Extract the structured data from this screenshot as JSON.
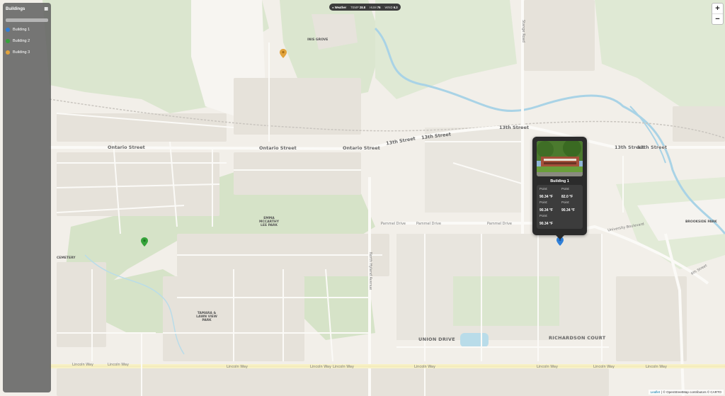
{
  "map": {
    "street_labels": {
      "ontario_w": "Ontario Street",
      "ontario_m": "Ontario Street",
      "ontario_e": "Ontario Street",
      "thirteenth_1": "13th Street",
      "thirteenth_2": "13th Street",
      "thirteenth_3": "13th Street",
      "thirteenth_4": "13th Street",
      "thirteenth_5": "13th Street",
      "lincoln_1": "Lincoln Way",
      "lincoln_2": "Lincoln Way",
      "lincoln_3": "Lincoln Way",
      "lincoln_4": "Lincoln Way",
      "lincoln_5": "Lincoln Way",
      "lincoln_6": "Lincoln Way",
      "lincoln_7": "Lincoln Way",
      "lincoln_8": "Lincoln Way",
      "lincoln_9": "Lincoln Way",
      "pammel_1": "Pammel Drive",
      "pammel_2": "Pammel Drive",
      "pammel_3": "Pammel Drive",
      "university_blvd": "University Boulevard",
      "north_hyland": "North Hyland Avenue",
      "stange_road": "Stange Road",
      "sixth_street": "6th Street"
    },
    "area_labels": {
      "union_drive": "UNION DRIVE",
      "richardson_court": "RICHARDSON COURT",
      "brookside_park": "BROOKSIDE PARK",
      "inis_grove": "INIS GROVE",
      "emma_mccarthy": "EMMA MCCARTHY LEE PARK",
      "cemetery": "CEMETERY",
      "tamara_park": "TAMARA & LAWN VIEW PARK"
    },
    "markers": [
      {
        "name": "Building 1",
        "color": "#2f7fd8"
      },
      {
        "name": "Building 2",
        "color": "#35a33a"
      },
      {
        "name": "Building 3",
        "color": "#e2a33c"
      }
    ]
  },
  "sidebar": {
    "title": "Buildings",
    "items": [
      {
        "label": "Building 1",
        "color": "#2f7fd8"
      },
      {
        "label": "Building 2",
        "color": "#35a33a"
      },
      {
        "label": "Building 3",
        "color": "#e2a33c"
      }
    ]
  },
  "weather": {
    "title": "Weather",
    "temp_label": "TEMP",
    "temp_value": "28.8",
    "hum_label": "HUM",
    "hum_value": "76",
    "wind_label": "WIND",
    "wind_value": "6.3"
  },
  "zoom": {
    "in": "+",
    "out": "−"
  },
  "popup": {
    "title": "Building 1",
    "cells": [
      {
        "label": "Point:",
        "value": "90.34 °F"
      },
      {
        "label": "Point:",
        "value": "82.0 °F"
      },
      {
        "label": "Point:",
        "value": "90.34 °F"
      },
      {
        "label": "Point:",
        "value": "90.34 °F"
      },
      {
        "label": "Point:",
        "value": "90.34 °F"
      }
    ]
  },
  "attribution": {
    "leaflet": "Leaflet",
    "text": "| © OpenStreetMap contributors © CARTO"
  }
}
